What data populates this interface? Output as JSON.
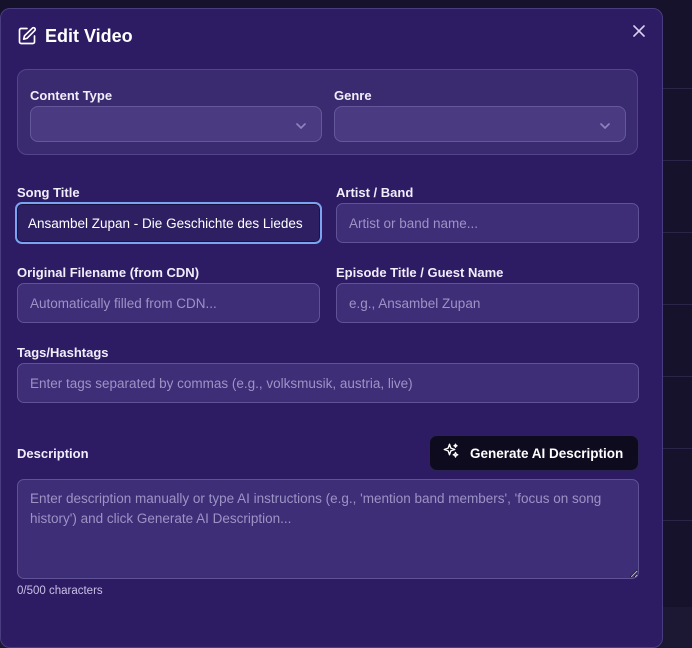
{
  "modal": {
    "title": "Edit Video",
    "title_icon": "edit-square-icon",
    "close_icon": "close-icon"
  },
  "content_type": {
    "label": "Content Type",
    "value": ""
  },
  "genre": {
    "label": "Genre",
    "value": ""
  },
  "song_title": {
    "label": "Song Title",
    "value": "Ansambel Zupan - Die Geschichte des Liedes"
  },
  "artist": {
    "label": "Artist / Band",
    "placeholder": "Artist or band name..."
  },
  "original_filename": {
    "label": "Original Filename (from CDN)",
    "placeholder": "Automatically filled from CDN..."
  },
  "episode_title": {
    "label": "Episode Title / Guest Name",
    "placeholder": "e.g., Ansambel Zupan"
  },
  "tags": {
    "label": "Tags/Hashtags",
    "placeholder": "Enter tags separated by commas (e.g., volksmusik, austria, live)"
  },
  "description": {
    "label": "Description",
    "placeholder": "Enter description manually or type AI instructions (e.g., 'mention band members', 'focus on song history') and click Generate AI Description...",
    "counter": "0/500 characters"
  },
  "ai_button": {
    "label": "Generate AI Description",
    "icon": "sparkles-icon"
  },
  "colors": {
    "modal_bg": "#2d1b64",
    "focus_ring": "#7aa4f0",
    "button_bg": "#0e0b1f"
  }
}
